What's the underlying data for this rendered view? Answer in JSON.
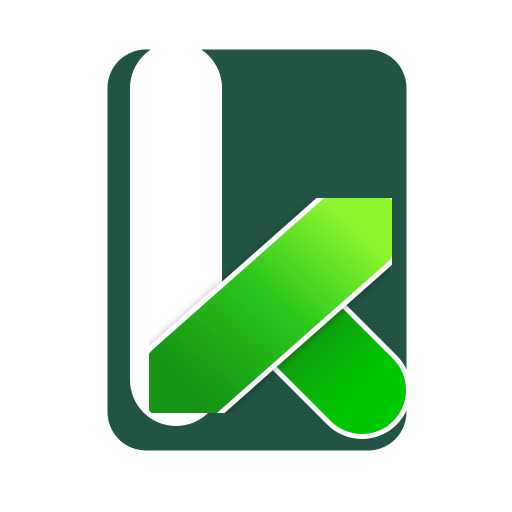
{
  "logo": {
    "icon": "k-letter-logo-icon",
    "colors": {
      "background": "#ffffff",
      "panel": "#215444",
      "outline": "#ffffff",
      "green_dark": "#139513",
      "green_mid": "#2fc81c",
      "green_light": "#8cf52f",
      "green_bright": "#00c800"
    }
  }
}
